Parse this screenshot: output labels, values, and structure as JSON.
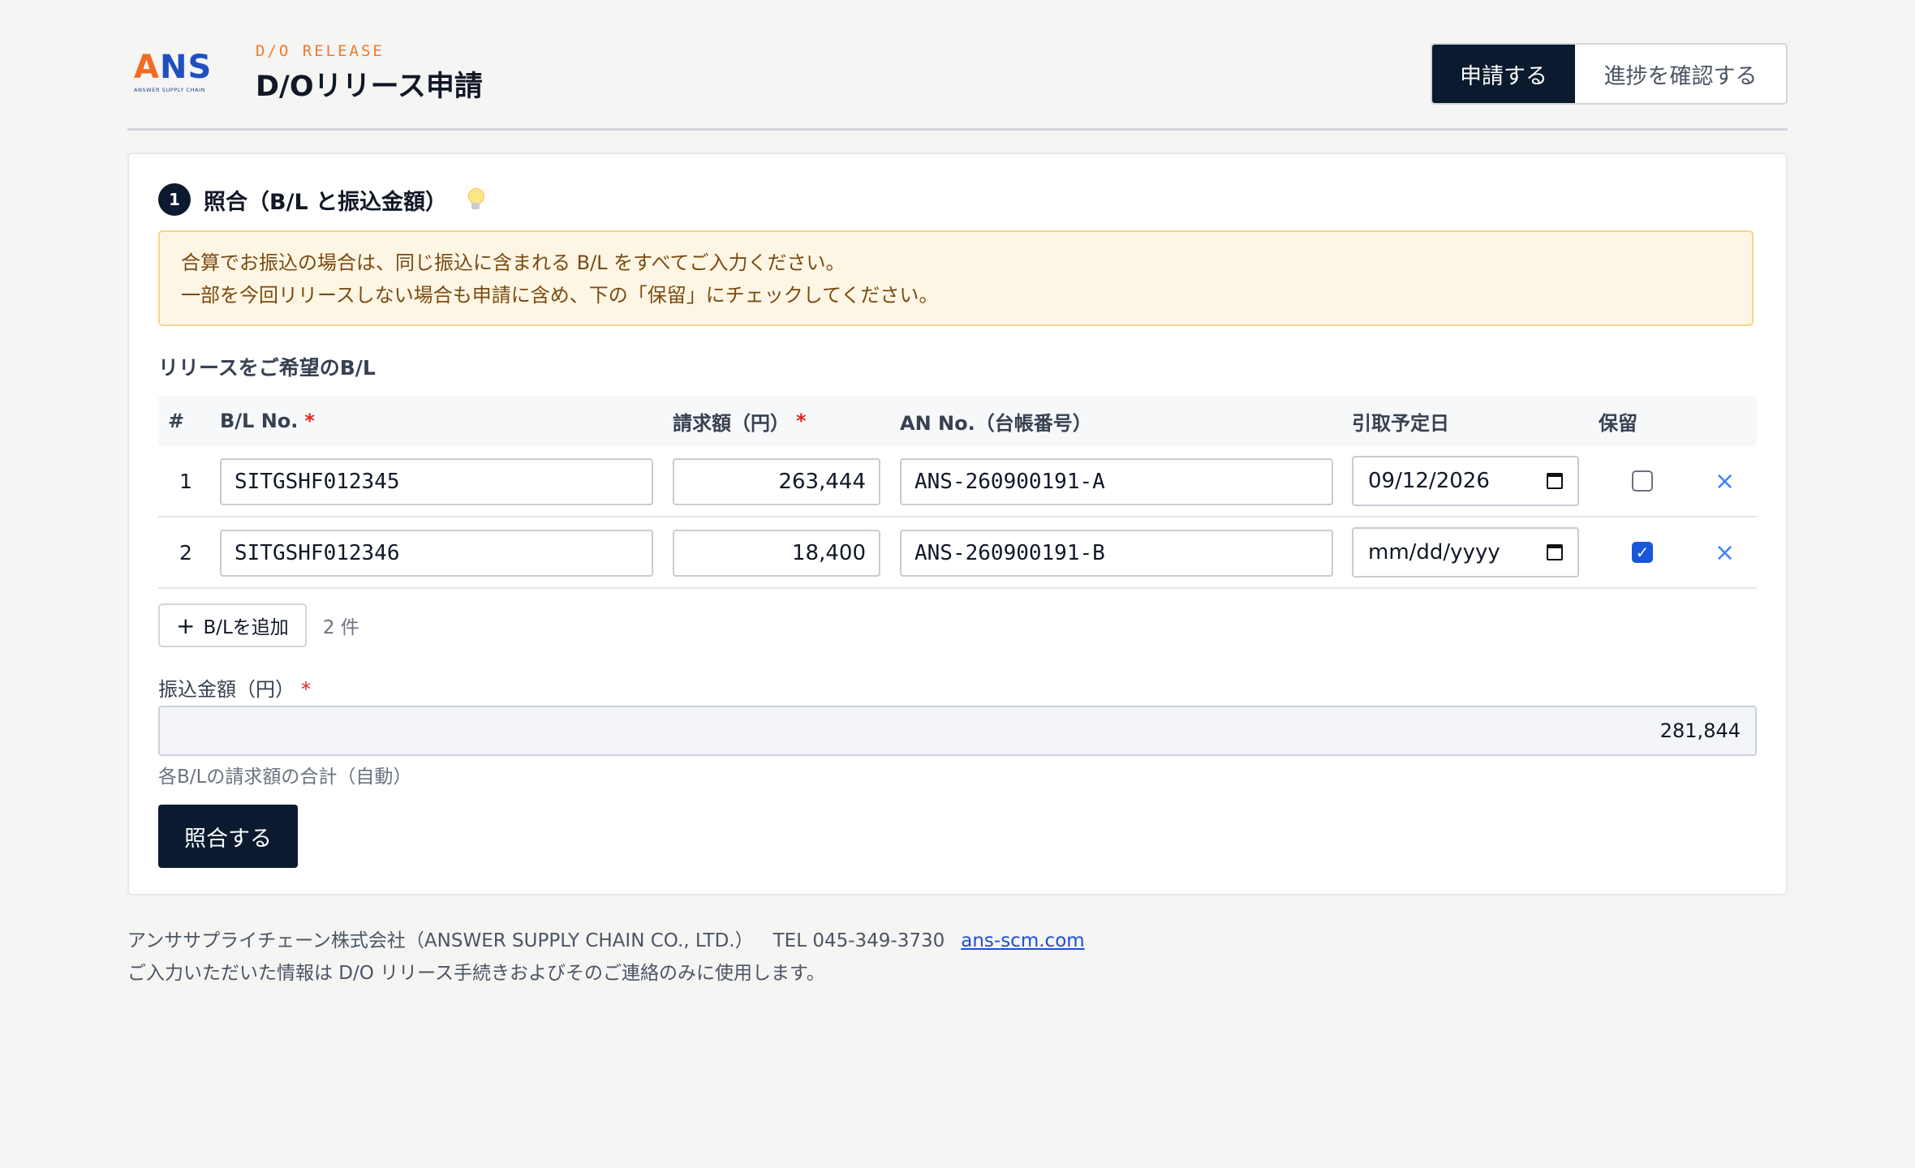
{
  "header": {
    "logo": {
      "letters": [
        "A",
        "N",
        "S"
      ],
      "tagline": "ANSWER SUPPLY CHAIN",
      "colors": {
        "orange": "#f26b21",
        "blue": "#2050c0"
      }
    },
    "eyebrow": "D/O RELEASE",
    "title": "D/Oリリース申請",
    "tabs": [
      {
        "label": "申請する",
        "active": true
      },
      {
        "label": "進捗を確認する",
        "active": false
      }
    ]
  },
  "step": {
    "number": "1",
    "title": "照合（B/L と振込金額）",
    "icon": "lightbulb-icon"
  },
  "notice": {
    "line1": "合算でお振込の場合は、同じ振込に含まれる B/L をすべてご入力ください。",
    "line2": "一部を今回リリースしない場合も申請に含め、下の「保留」にチェックしてください。"
  },
  "section_label": "リリースをご希望のB/L",
  "table": {
    "headers": {
      "index": "#",
      "bl_no": "B/L No.",
      "amount": "請求額（円）",
      "an_no": "AN No.（台帳番号）",
      "pickup": "引取予定日",
      "hold": "保留",
      "required_mark": "*"
    },
    "rows": [
      {
        "index": "1",
        "bl_no": "SITGSHF012345",
        "amount": "263,444",
        "an_no": "ANS-260900191-A",
        "pickup": "09/12/2026",
        "hold": false
      },
      {
        "index": "2",
        "bl_no": "SITGSHF012346",
        "amount": "18,400",
        "an_no": "ANS-260900191-B",
        "pickup": "mm/dd/yyyy",
        "hold": true
      }
    ],
    "delete_glyph": "×"
  },
  "add_button": {
    "plus": "+",
    "label": "B/Lを追加"
  },
  "count": "2 件",
  "transfer": {
    "label": "振込金額（円）",
    "required_mark": "*",
    "value": "281,844",
    "help": "各B/Lの請求額の合計（自動）"
  },
  "submit_label": "照合する",
  "footer": {
    "company": "アンササプライチェーン株式会社（ANSWER SUPPLY CHAIN CO., LTD.）",
    "tel": "TEL 045-349-3730",
    "link": "ans-scm.com",
    "note": "ご入力いただいた情報は D/O リリース手続きおよびそのご連絡のみに使用します。"
  }
}
